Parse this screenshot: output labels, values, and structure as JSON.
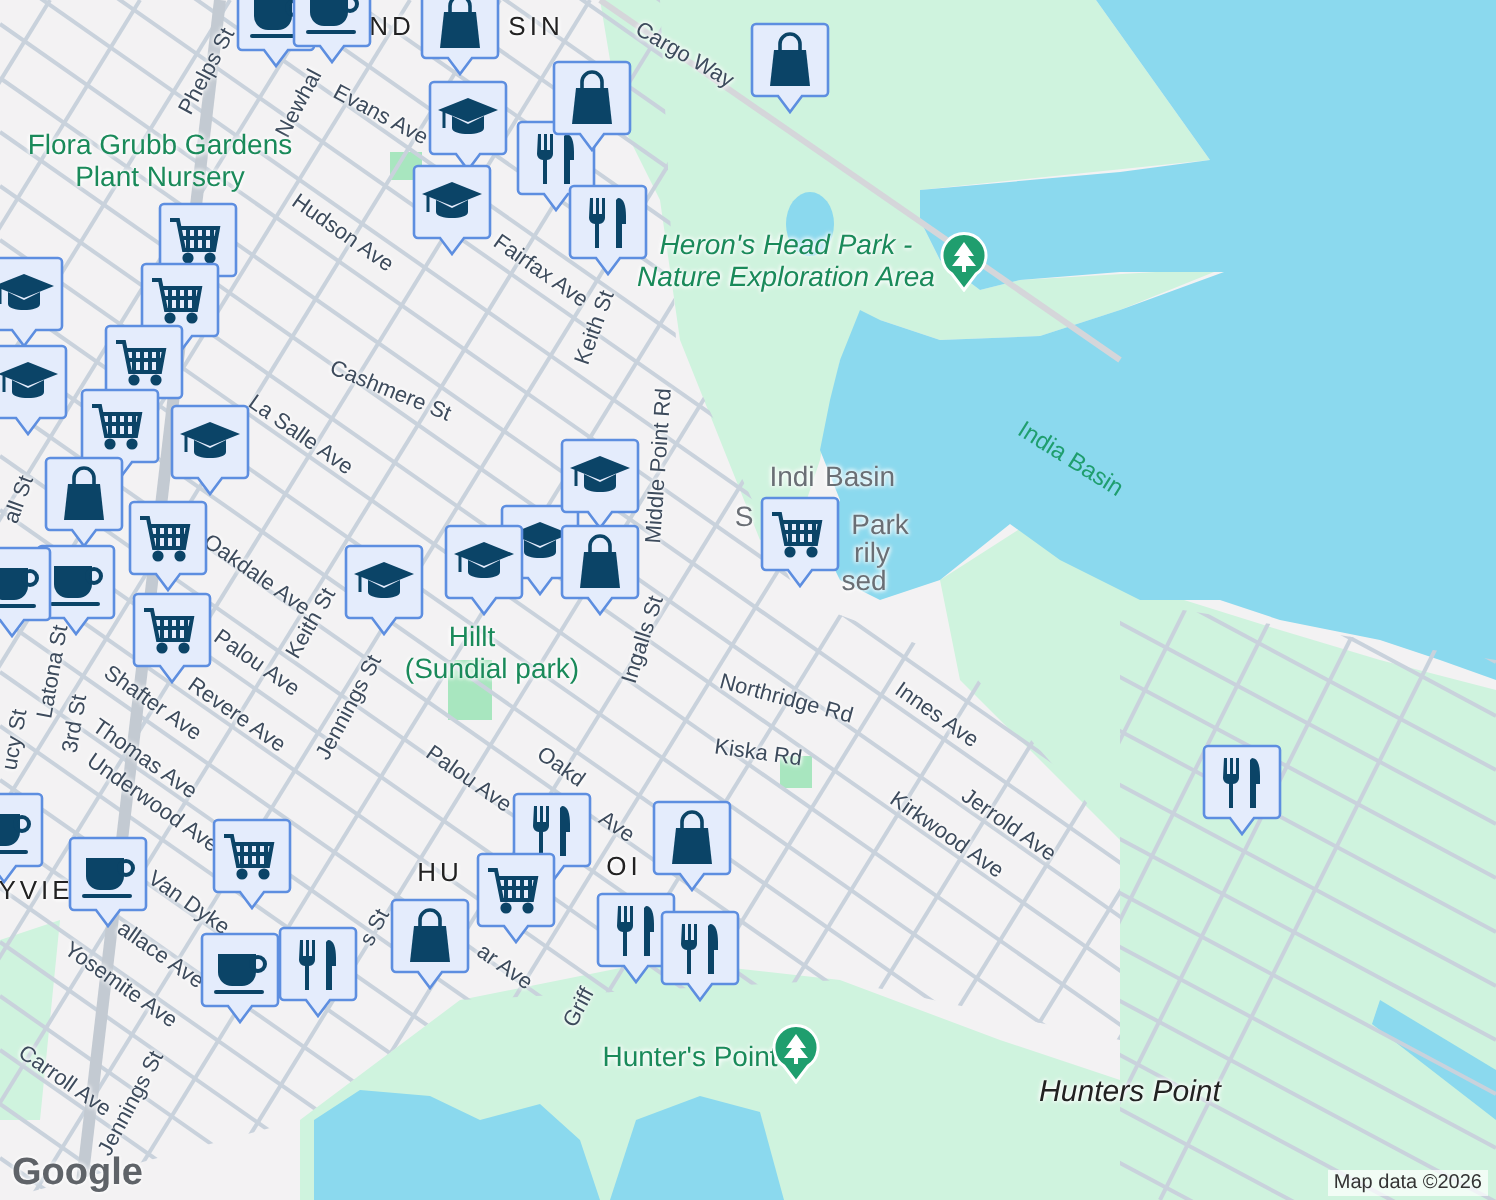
{
  "labels": [
    {
      "text": "Phelps St",
      "kind": "street"
    },
    {
      "text": "Newhal",
      "kind": "street"
    },
    {
      "text": "Evans Ave",
      "kind": "street"
    },
    {
      "text": "ND",
      "kind": "district"
    },
    {
      "text": "SIN",
      "kind": "district"
    },
    {
      "text": "Cargo Way",
      "kind": "street"
    },
    {
      "text": "Flora Grubb Gardens Plant Nursery",
      "kind": "park"
    },
    {
      "text": "Hudson Ave",
      "kind": "street"
    },
    {
      "text": "Fairfax Ave",
      "kind": "street"
    },
    {
      "text": "Keith St",
      "kind": "street"
    },
    {
      "text": "Heron's Head Park - Nature Exploration Area",
      "kind": "park_italic"
    },
    {
      "text": "Cashmere St",
      "kind": "street"
    },
    {
      "text": "La Salle Ave",
      "kind": "street"
    },
    {
      "text": "Middle Point Rd",
      "kind": "street"
    },
    {
      "text": "India Basin",
      "kind": "water"
    },
    {
      "text": "Indi",
      "kind": "poi"
    },
    {
      "text": "Basin",
      "kind": "poi"
    },
    {
      "text": "S",
      "kind": "poi"
    },
    {
      "text": "Park",
      "kind": "poi"
    },
    {
      "text": "rily",
      "kind": "poi"
    },
    {
      "text": "sed",
      "kind": "poi"
    },
    {
      "text": "Oakdale Ave",
      "kind": "street"
    },
    {
      "text": "Keith St",
      "kind": "street"
    },
    {
      "text": "Hillt",
      "kind": "park"
    },
    {
      "text": "(Sundial park)",
      "kind": "park"
    },
    {
      "text": "Ingalls St",
      "kind": "street"
    },
    {
      "text": "Palou Ave",
      "kind": "street"
    },
    {
      "text": "all St",
      "kind": "street"
    },
    {
      "text": "Latona St",
      "kind": "street"
    },
    {
      "text": "3rd St",
      "kind": "street"
    },
    {
      "text": "Revere Ave",
      "kind": "street"
    },
    {
      "text": "Shafter Ave",
      "kind": "street"
    },
    {
      "text": "Northridge Rd",
      "kind": "street"
    },
    {
      "text": "Innes Ave",
      "kind": "street"
    },
    {
      "text": "Thomas Ave",
      "kind": "street"
    },
    {
      "text": "Kiska Rd",
      "kind": "street"
    },
    {
      "text": "ucy St",
      "kind": "street"
    },
    {
      "text": "Jennings St",
      "kind": "street"
    },
    {
      "text": "Palou Ave",
      "kind": "street"
    },
    {
      "text": "Oakd",
      "kind": "street"
    },
    {
      "text": "Ave",
      "kind": "street"
    },
    {
      "text": "Underwood Ave",
      "kind": "street"
    },
    {
      "text": "Jerrold Ave",
      "kind": "street"
    },
    {
      "text": "Kirkwood Ave",
      "kind": "street"
    },
    {
      "text": "HU",
      "kind": "district"
    },
    {
      "text": "OI",
      "kind": "district"
    },
    {
      "text": "YVIE",
      "kind": "district"
    },
    {
      "text": "Van Dyke",
      "kind": "street"
    },
    {
      "text": "allace Ave",
      "kind": "street"
    },
    {
      "text": "ar Ave",
      "kind": "street"
    },
    {
      "text": "Griff",
      "kind": "street"
    },
    {
      "text": "Yosemite Ave",
      "kind": "street"
    },
    {
      "text": "s St",
      "kind": "street"
    },
    {
      "text": "Hunter's Point",
      "kind": "park"
    },
    {
      "text": "Hunters Point",
      "kind": "area"
    },
    {
      "text": "Carroll Ave",
      "kind": "street"
    },
    {
      "text": "Jennings St",
      "kind": "street"
    }
  ],
  "markers": [
    {
      "kind": "cafe"
    },
    {
      "kind": "cafe"
    },
    {
      "kind": "shop"
    },
    {
      "kind": "school"
    },
    {
      "kind": "restaurant"
    },
    {
      "kind": "shop"
    },
    {
      "kind": "school"
    },
    {
      "kind": "restaurant"
    },
    {
      "kind": "shop"
    },
    {
      "kind": "school"
    },
    {
      "kind": "grocery"
    },
    {
      "kind": "grocery"
    },
    {
      "kind": "grocery"
    },
    {
      "kind": "grocery"
    },
    {
      "kind": "shop"
    },
    {
      "kind": "school"
    },
    {
      "kind": "grocery"
    },
    {
      "kind": "school"
    },
    {
      "kind": "cafe"
    },
    {
      "kind": "cafe"
    },
    {
      "kind": "grocery"
    },
    {
      "kind": "school"
    },
    {
      "kind": "school"
    },
    {
      "kind": "school"
    },
    {
      "kind": "school"
    },
    {
      "kind": "shop"
    },
    {
      "kind": "grocery"
    },
    {
      "kind": "cafe"
    },
    {
      "kind": "cafe"
    },
    {
      "kind": "grocery"
    },
    {
      "kind": "cafe"
    },
    {
      "kind": "restaurant"
    },
    {
      "kind": "shop"
    },
    {
      "kind": "restaurant"
    },
    {
      "kind": "grocery"
    },
    {
      "kind": "shop"
    },
    {
      "kind": "restaurant"
    },
    {
      "kind": "restaurant"
    },
    {
      "kind": "restaurant"
    }
  ],
  "attribution": {
    "logo": "Google",
    "text": "Map data ©2026"
  }
}
